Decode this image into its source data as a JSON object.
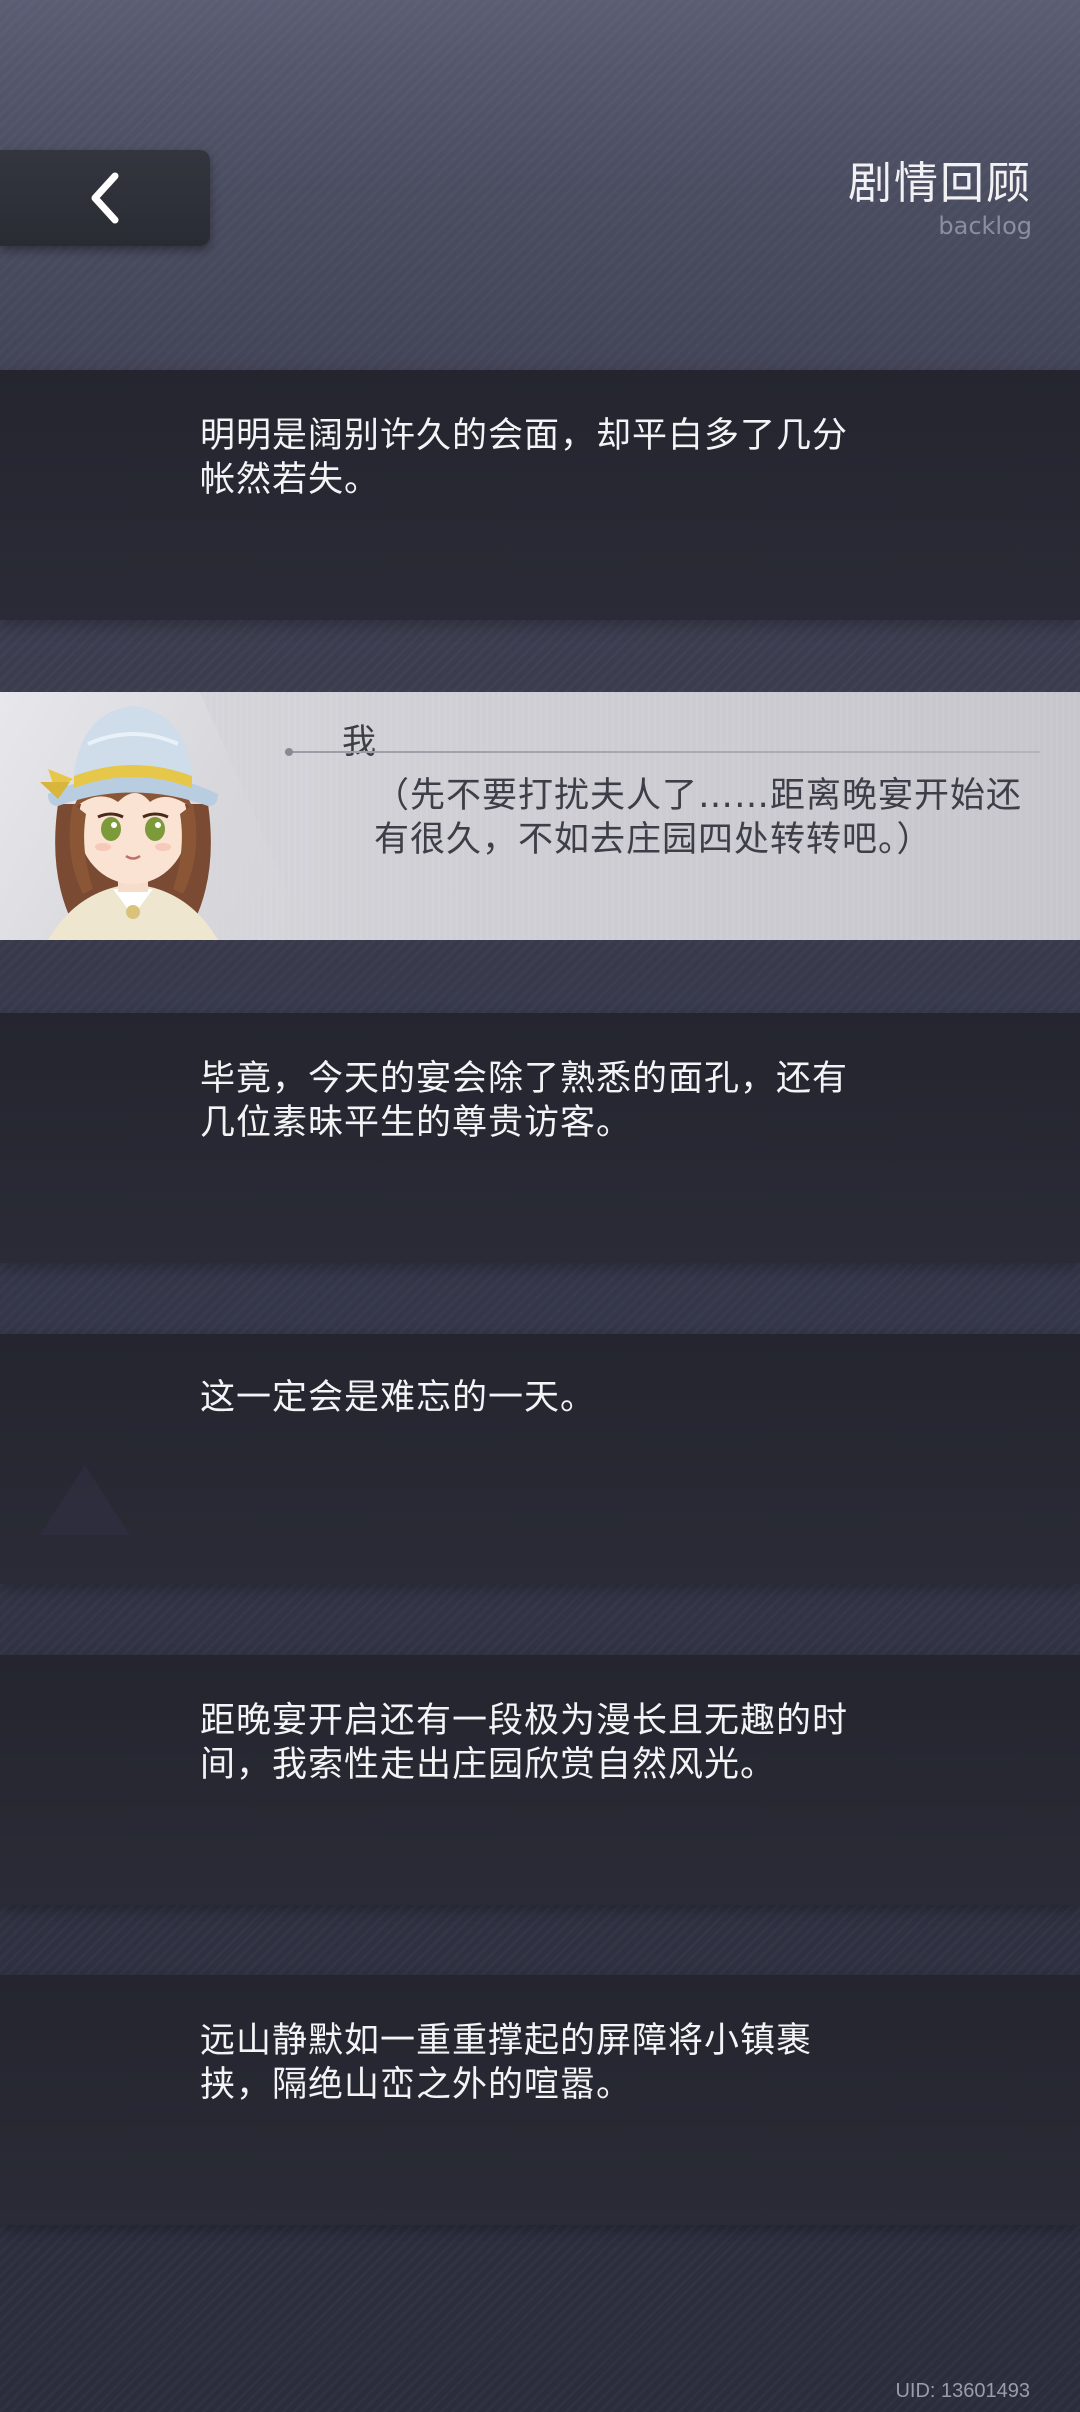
{
  "header": {
    "back_icon": "chevron-left-icon",
    "title": "剧情回顾",
    "subtitle": "backlog"
  },
  "entries": [
    {
      "type": "narration",
      "text": "明明是阔别许久的会面，却平白多了几分帐然若失。"
    },
    {
      "type": "dialogue",
      "speaker": "我",
      "text": "（先不要打扰夫人了……距离晚宴开始还有很久，不如去庄园四处转转吧。）",
      "avatar_icon": "girl-portrait-avatar"
    },
    {
      "type": "narration",
      "text": "毕竟，今天的宴会除了熟悉的面孔，还有几位素昧平生的尊贵访客。"
    },
    {
      "type": "narration",
      "text": "这一定会是难忘的一天。"
    },
    {
      "type": "narration",
      "text": "距晚宴开启还有一段极为漫长且无趣的时间，我索性走出庄园欣赏自然风光。"
    },
    {
      "type": "narration",
      "text": "远山静默如一重重撑起的屏障将小镇裹挟，隔绝山峦之外的喧嚣。"
    }
  ],
  "footer": {
    "uid": "UID: 13601493"
  },
  "colors": {
    "panel_dark": "#24252f",
    "dialog_light": "#cfcfd5",
    "text_light": "#f4f4f6",
    "text_dark": "#3e3e48"
  }
}
